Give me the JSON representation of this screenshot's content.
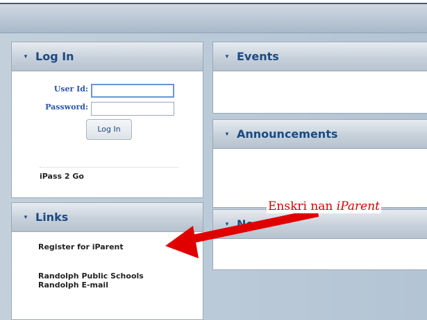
{
  "login": {
    "title": "Log In",
    "user_id_label": "User Id:",
    "password_label": "Password:",
    "user_id_value": "",
    "password_value": "",
    "button_label": "Log In",
    "ipass_link": "iPass 2 Go"
  },
  "links": {
    "title": "Links",
    "items": [
      "Register for iParent",
      "Randolph Public Schools",
      "Randolph E-mail"
    ]
  },
  "events": {
    "title": "Events"
  },
  "announcements": {
    "title": "Announcements"
  },
  "news": {
    "title": "Ne"
  },
  "callout": {
    "prefix": "Enskri nan ",
    "emphasis": "iParent"
  },
  "colors": {
    "header_text": "#1b4a82",
    "label_text": "#2b55a6",
    "annotation_red": "#d40000",
    "background": "#b9c8d6"
  },
  "icons": {
    "collapse": "chevron-down-icon"
  }
}
